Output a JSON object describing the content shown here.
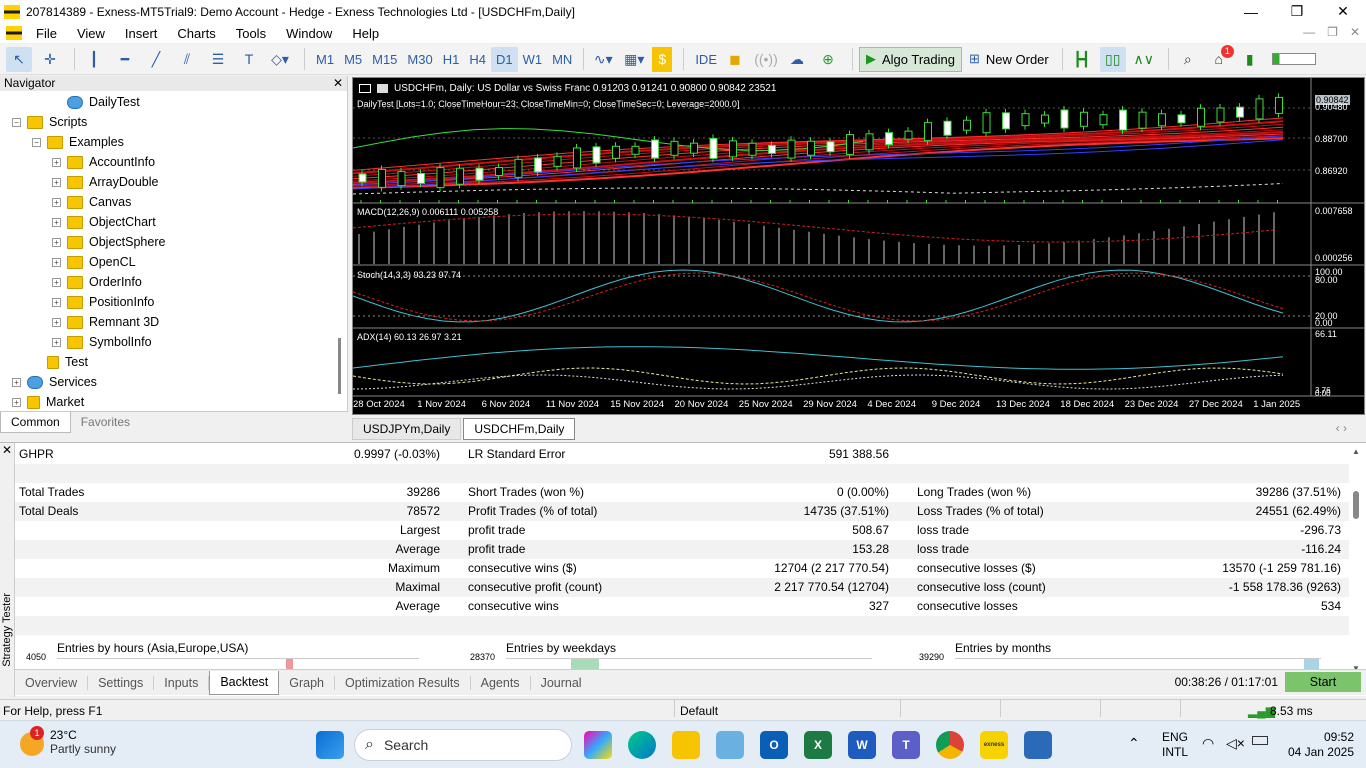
{
  "window": {
    "title": "207814389 - Exness-MT5Trial9: Demo Account - Hedge - Exness Technologies Ltd - [USDCHFm,Daily]"
  },
  "menu": [
    "File",
    "View",
    "Insert",
    "Charts",
    "Tools",
    "Window",
    "Help"
  ],
  "toolbar": {
    "timeframes": [
      "M1",
      "M5",
      "M15",
      "M30",
      "H1",
      "H4",
      "D1",
      "W1",
      "MN"
    ],
    "selected_timeframe": "D1",
    "ide_label": "IDE",
    "algo_trading_label": "Algo Trading",
    "new_order_label": "New Order",
    "notification_count": "1"
  },
  "navigator": {
    "title": "Navigator",
    "items": [
      {
        "label": "DailyTest",
        "type": "expert"
      },
      {
        "label": "Scripts",
        "type": "folder"
      },
      {
        "label": "Examples",
        "type": "folder"
      },
      {
        "label": "AccountInfo",
        "type": "folder"
      },
      {
        "label": "ArrayDouble",
        "type": "folder"
      },
      {
        "label": "Canvas",
        "type": "folder"
      },
      {
        "label": "ObjectChart",
        "type": "folder"
      },
      {
        "label": "ObjectSphere",
        "type": "folder"
      },
      {
        "label": "OpenCL",
        "type": "folder"
      },
      {
        "label": "OrderInfo",
        "type": "folder"
      },
      {
        "label": "PositionInfo",
        "type": "folder"
      },
      {
        "label": "Remnant 3D",
        "type": "folder"
      },
      {
        "label": "SymbolInfo",
        "type": "folder"
      },
      {
        "label": "Test",
        "type": "script"
      },
      {
        "label": "Services",
        "type": "services"
      },
      {
        "label": "Market",
        "type": "market"
      }
    ],
    "tabs": [
      "Common",
      "Favorites"
    ]
  },
  "chart": {
    "header": "USDCHFm, Daily:  US Dollar vs Swiss Franc  0.91203  0.91241  0.90800  0.90842  23521",
    "ea_label": "DailyTest [Lots=1.0; CloseTimeHour=23; CloseTimeMin=0; CloseTimeSec=0; Leverage=2000.0]",
    "price_labels": [
      "0.90842",
      "0.90480",
      "0.88700",
      "0.86920"
    ],
    "macd_label": "MACD(12,26,9) 0.006111 0.005258",
    "macd_scale": [
      "0.007658",
      "0.000256"
    ],
    "stoch_label": "Stoch(14,3,3) 93.23 97.74",
    "stoch_scale": [
      "100.00",
      "80.00",
      "20.00",
      "0.00"
    ],
    "adx_label": "ADX(14) 60.13 26.97 3.21",
    "adx_scale": [
      "66.11",
      "3.76",
      "0.00"
    ],
    "dates": [
      "28 Oct 2024",
      "1 Nov 2024",
      "6 Nov 2024",
      "11 Nov 2024",
      "15 Nov 2024",
      "20 Nov 2024",
      "25 Nov 2024",
      "29 Nov 2024",
      "4 Dec 2024",
      "9 Dec 2024",
      "13 Dec 2024",
      "18 Dec 2024",
      "23 Dec 2024",
      "27 Dec 2024",
      "1 Jan 2025"
    ],
    "tabs": [
      "USDJPYm,Daily",
      "USDCHFm,Daily"
    ],
    "active_tab": "USDCHFm,Daily"
  },
  "tester": {
    "side_label": "Strategy Tester",
    "ghpr_label": "GHPR",
    "ghpr_value": "0.9997 (-0.03%)",
    "lr_label": "LR Standard Error",
    "lr_value": "591 388.56",
    "rows": [
      {
        "c1": "Total Trades",
        "v1": "39286",
        "c2": "Short Trades (won %)",
        "v2": "0 (0.00%)",
        "c3": "Long Trades (won %)",
        "v3": "39286 (37.51%)"
      },
      {
        "c1": "Total Deals",
        "v1": "78572",
        "c2": "Profit Trades (% of total)",
        "v2": "14735 (37.51%)",
        "c3": "Loss Trades (% of total)",
        "v3": "24551 (62.49%)"
      },
      {
        "c1": "",
        "v1": "Largest",
        "c2": "profit trade",
        "v2": "508.67",
        "c3": "loss trade",
        "v3": "-296.73"
      },
      {
        "c1": "",
        "v1": "Average",
        "c2": "profit trade",
        "v2": "153.28",
        "c3": "loss trade",
        "v3": "-116.24"
      },
      {
        "c1": "",
        "v1": "Maximum",
        "c2": "consecutive wins ($)",
        "v2": "12704 (2 217 770.54)",
        "c3": "consecutive losses ($)",
        "v3": "13570 (-1 259 781.16)"
      },
      {
        "c1": "",
        "v1": "Maximal",
        "c2": "consecutive profit (count)",
        "v2": "2 217 770.54 (12704)",
        "c3": "consecutive loss (count)",
        "v3": "-1 558 178.36 (9263)"
      },
      {
        "c1": "",
        "v1": "Average",
        "c2": "consecutive wins",
        "v2": "327",
        "c3": "consecutive losses",
        "v3": "534"
      }
    ],
    "hours_title": "Entries by hours (Asia,Europe,USA)",
    "hours_max": "4050",
    "weekdays_title": "Entries by weekdays",
    "weekdays_max": "28370",
    "months_title": "Entries by months",
    "months_max": "39290",
    "tabs": [
      "Overview",
      "Settings",
      "Inputs",
      "Backtest",
      "Graph",
      "Optimization Results",
      "Agents",
      "Journal"
    ],
    "active_tab": "Backtest",
    "timer": "00:38:26 / 01:17:01",
    "start_label": "Start"
  },
  "status": {
    "help": "For Help, press F1",
    "profile": "Default",
    "ping": "8.53 ms"
  },
  "taskbar": {
    "weather_temp": "23°C",
    "weather_desc": "Partly sunny",
    "weather_badge": "1",
    "search_placeholder": "Search",
    "lang1": "ENG",
    "lang2": "INTL",
    "time": "09:52",
    "date": "04 Jan 2025"
  }
}
